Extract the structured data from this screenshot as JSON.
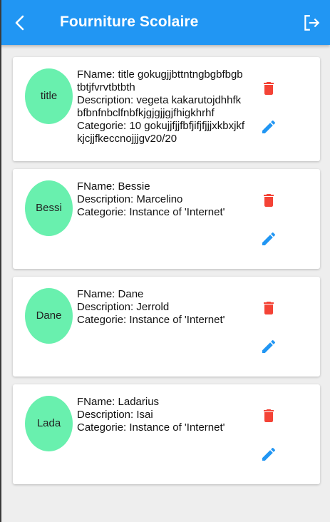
{
  "app_bar": {
    "title": "Fourniture Scolaire",
    "back_icon": "arrow-back-icon",
    "logout_icon": "logout-icon",
    "background_color": "#2196f3"
  },
  "labels": {
    "name_prefix": "FName: ",
    "description_prefix": "Description: ",
    "categorie_prefix": "Categorie: "
  },
  "colors": {
    "avatar": "#69f0ae",
    "delete": "#f44336",
    "edit": "#2196f3"
  },
  "items": [
    {
      "avatar_text": "title",
      "name": "title gokugjjbttntngbgbfbgbtbtjfvrvtbtbth",
      "description": "vegeta kakarutojdhhfkbfbnfnbclfnbfkjgjgjjgjfhigkhrhf",
      "categorie": "10 gokujjfjjfbfjifjfjjjxkbxjkfkjcjjfkeccnojjjgv20/20"
    },
    {
      "avatar_text": "Bessi",
      "name": "Bessie",
      "description": "Marcelino",
      "categorie": "Instance of 'Internet'"
    },
    {
      "avatar_text": "Dane",
      "name": "Dane",
      "description": "Jerrold",
      "categorie": "Instance of 'Internet'"
    },
    {
      "avatar_text": "Lada",
      "name": "Ladarius",
      "description": "Isai",
      "categorie": "Instance of 'Internet'"
    }
  ]
}
